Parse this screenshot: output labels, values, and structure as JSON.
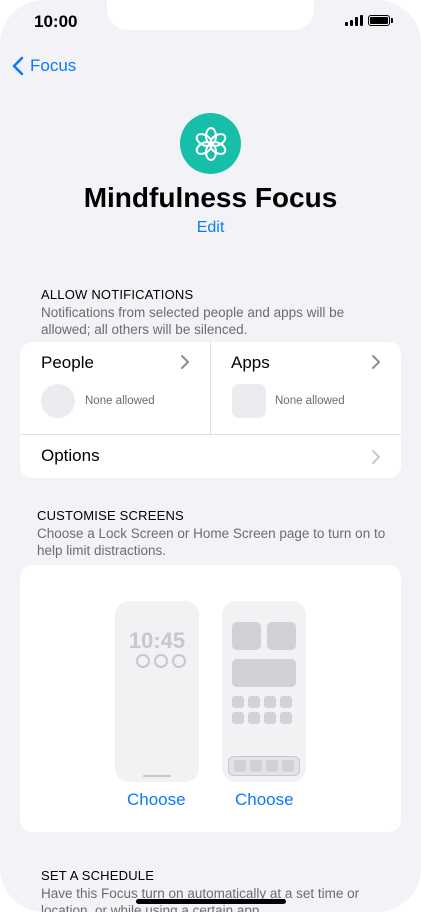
{
  "status": {
    "time": "10:00"
  },
  "nav": {
    "back_label": "Focus"
  },
  "header": {
    "title": "Mindfulness Focus",
    "edit_label": "Edit"
  },
  "allow_notifications": {
    "heading": "ALLOW NOTIFICATIONS",
    "description": "Notifications from selected people and apps will be allowed; all others will be silenced.",
    "people_label": "People",
    "people_status": "None allowed",
    "apps_label": "Apps",
    "apps_status": "None allowed",
    "options_label": "Options"
  },
  "customise": {
    "heading": "CUSTOMISE SCREENS",
    "description": "Choose a Lock Screen or Home Screen page to turn on to help limit distractions.",
    "lock_time": "10:45",
    "choose_lock": "Choose",
    "choose_home": "Choose"
  },
  "schedule": {
    "heading": "SET A SCHEDULE",
    "description": "Have this Focus turn on automatically at a set time or location, or while using a certain app."
  },
  "colors": {
    "accent": "#0a7aff",
    "focus_teal": "#17bfa8",
    "background": "#f2f2f7"
  }
}
